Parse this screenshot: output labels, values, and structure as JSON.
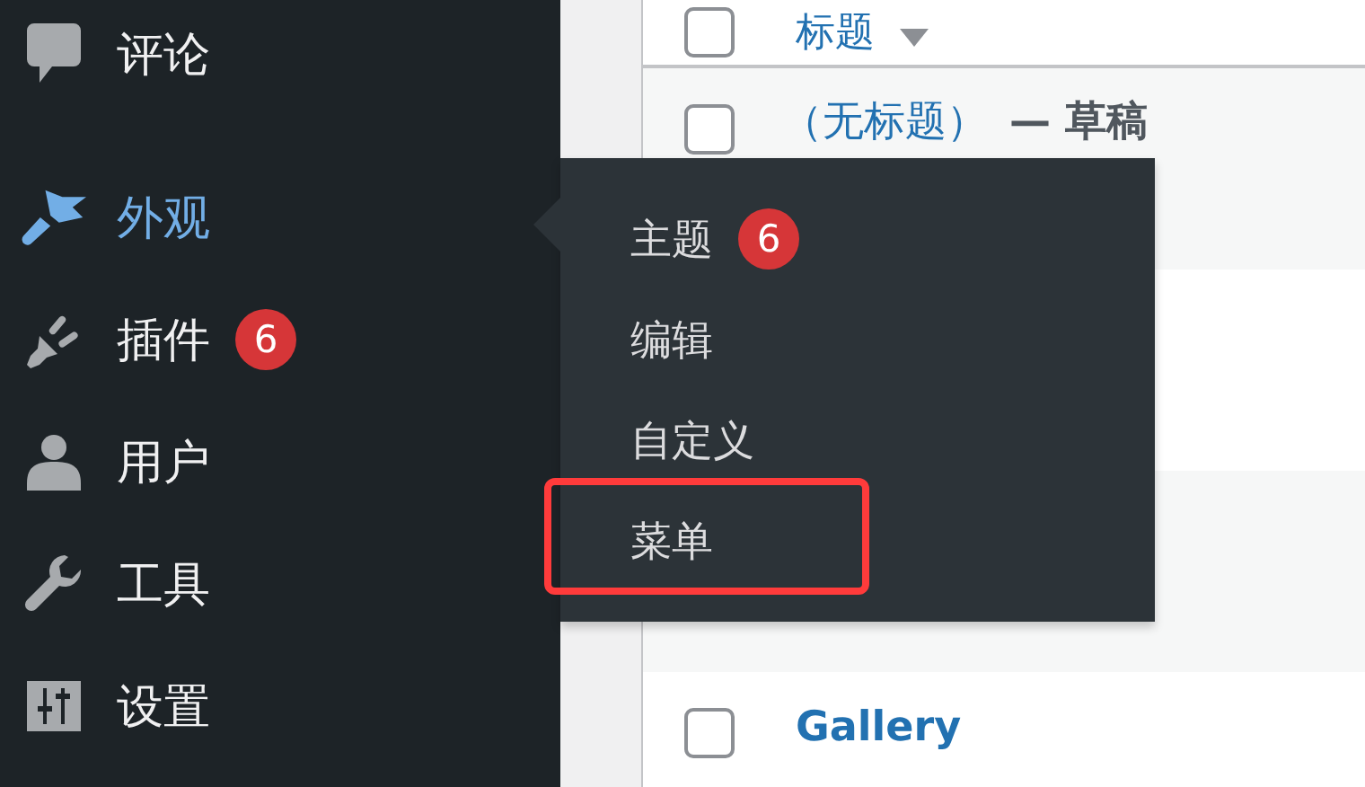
{
  "sidebar": {
    "items": [
      {
        "label": "评论",
        "selected": false
      },
      {
        "label": "外观",
        "selected": true
      },
      {
        "label": "插件",
        "selected": false,
        "badge": "6"
      },
      {
        "label": "用户",
        "selected": false
      },
      {
        "label": "工具",
        "selected": false
      },
      {
        "label": "设置",
        "selected": false
      }
    ]
  },
  "submenu": {
    "items": [
      {
        "label": "主题",
        "badge": "6",
        "highlighted": false
      },
      {
        "label": "编辑",
        "highlighted": false
      },
      {
        "label": "自定义",
        "highlighted": false
      },
      {
        "label": "菜单",
        "highlighted": true
      }
    ]
  },
  "table": {
    "select_all": {
      "checked": false
    },
    "columns": [
      {
        "label": "标题",
        "sorted": true
      }
    ],
    "rows": [
      {
        "checked": false,
        "title": "（无标题）",
        "state": "— 草稿"
      },
      {},
      {},
      {
        "checked": false,
        "title": "Gallery"
      }
    ]
  }
}
